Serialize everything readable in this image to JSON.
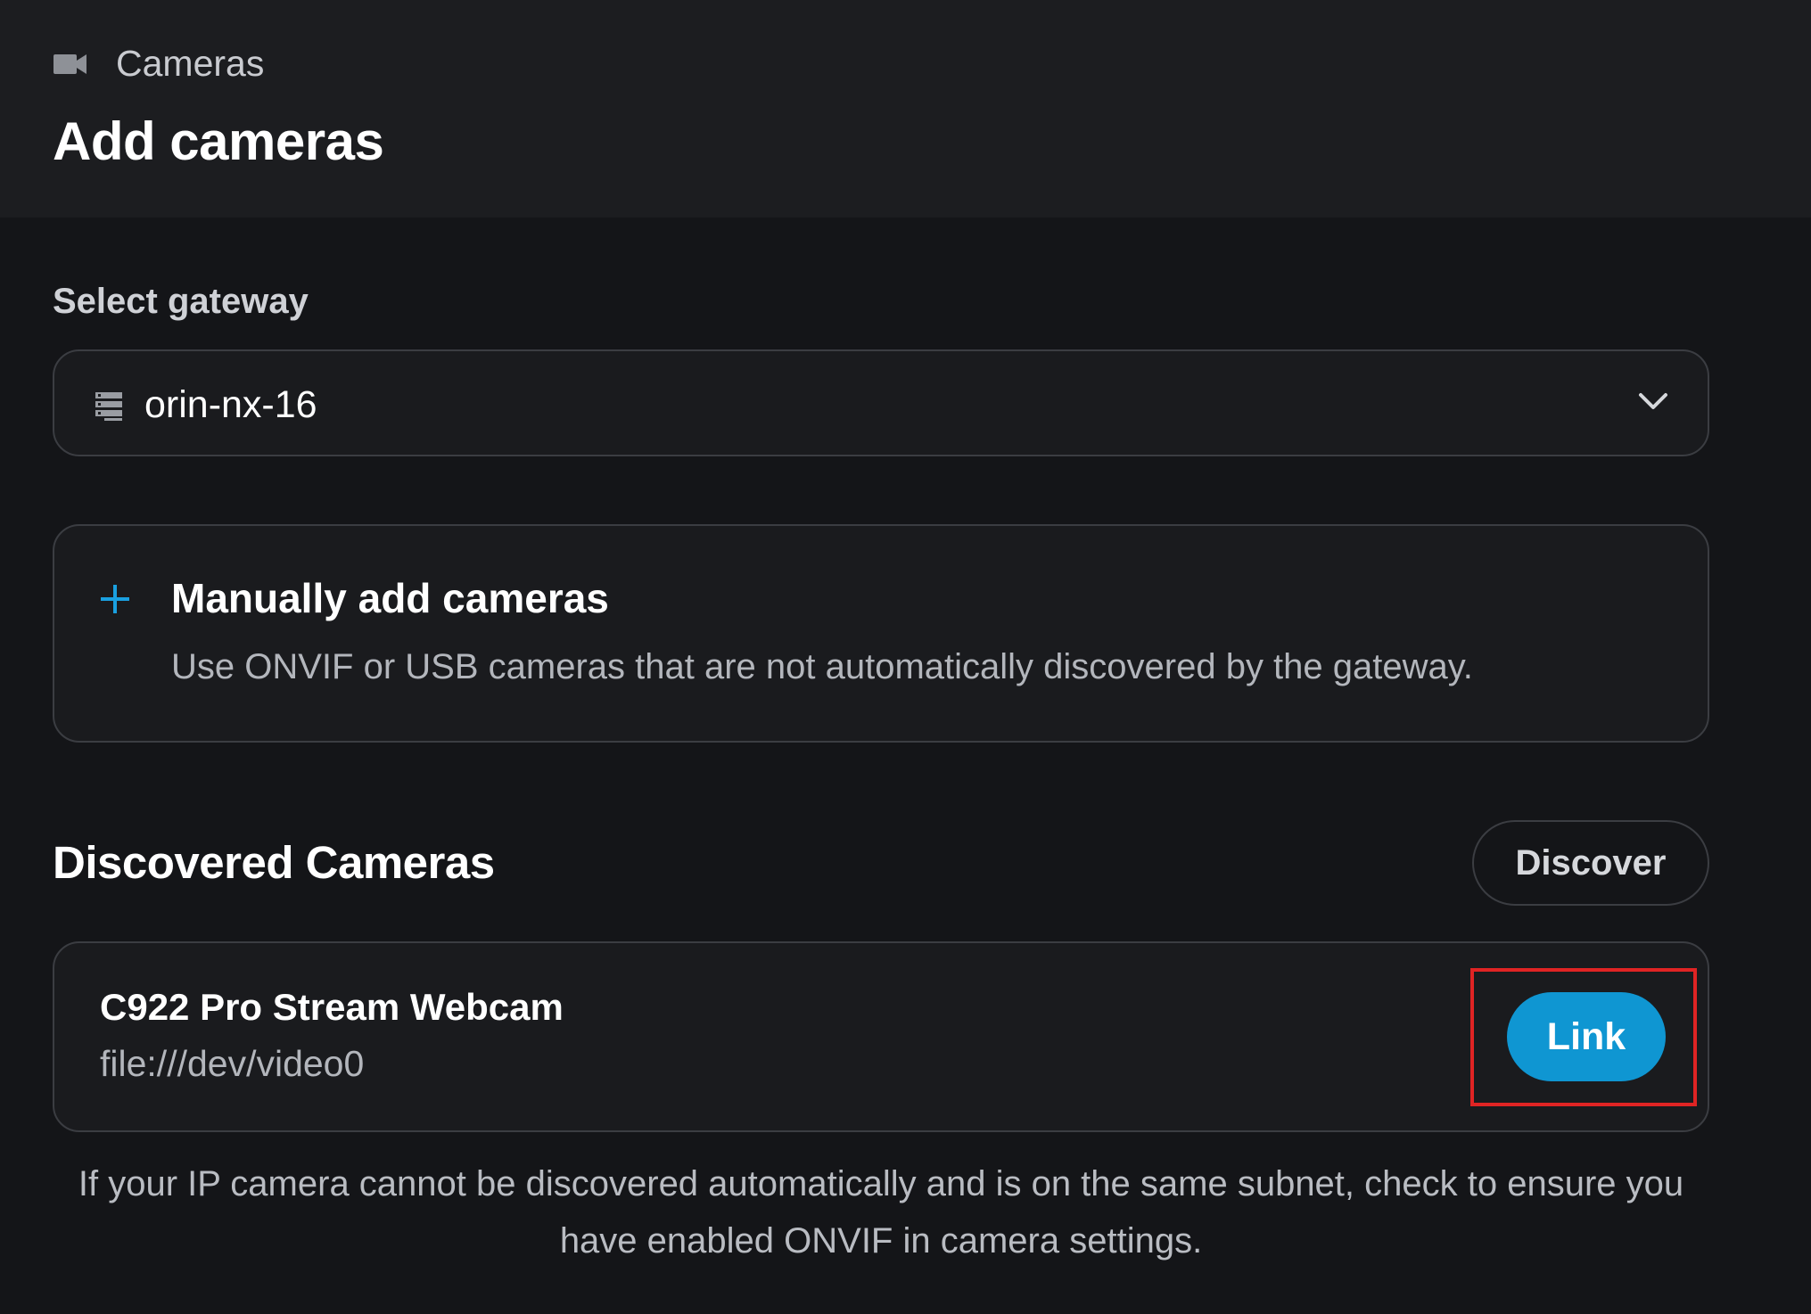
{
  "header": {
    "breadcrumb": {
      "icon": "video-camera-icon",
      "label": "Cameras"
    },
    "title": "Add cameras"
  },
  "gateway": {
    "label": "Select gateway",
    "icon": "server-icon",
    "selected": "orin-nx-16",
    "chevron_icon": "chevron-down-icon"
  },
  "manual_add": {
    "icon": "plus-icon",
    "title": "Manually add cameras",
    "description": "Use ONVIF or USB cameras that are not automatically discovered by the gateway."
  },
  "discovered": {
    "heading": "Discovered Cameras",
    "discover_label": "Discover",
    "cameras": [
      {
        "name": "C922 Pro Stream Webcam",
        "uri": "file:///dev/video0",
        "action_label": "Link"
      }
    ],
    "note": "If your IP camera cannot be discovered automatically and is on the same subnet, check to ensure you have enabled ONVIF in camera settings."
  },
  "colors": {
    "background": "#141518",
    "header_background": "#1c1d20",
    "accent": "#0f96d2",
    "highlight": "#e02424",
    "border": "#3b3d42"
  }
}
